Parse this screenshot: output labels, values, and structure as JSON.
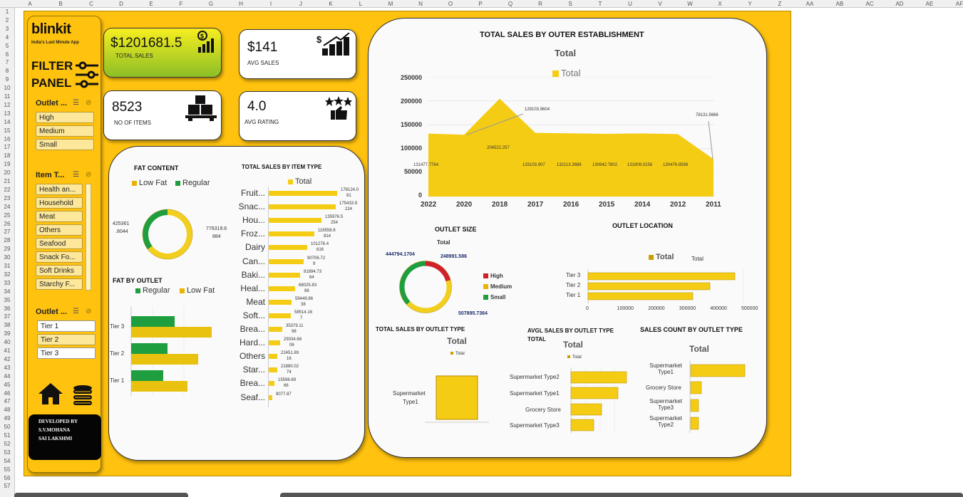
{
  "sheet": {
    "columns": [
      "A",
      "B",
      "C",
      "D",
      "E",
      "F",
      "G",
      "H",
      "I",
      "J",
      "K",
      "L",
      "M",
      "N",
      "O",
      "P",
      "Q",
      "R",
      "S",
      "T",
      "U",
      "V",
      "W",
      "X",
      "Y",
      "Z",
      "AA",
      "AB",
      "AC",
      "AD",
      "AE",
      "AF"
    ],
    "rows": [
      "1",
      "2",
      "3",
      "4",
      "5",
      "6",
      "7",
      "8",
      "9",
      "10",
      "11",
      "12",
      "13",
      "14",
      "15",
      "16",
      "17",
      "18",
      "19",
      "20",
      "21",
      "22",
      "23",
      "24",
      "25",
      "26",
      "27",
      "28",
      "29",
      "30",
      "31",
      "32",
      "33",
      "34",
      "35",
      "36",
      "37",
      "38",
      "39",
      "40",
      "41",
      "42",
      "43",
      "44",
      "45",
      "46",
      "47",
      "48",
      "49",
      "50",
      "51",
      "52",
      "53",
      "54",
      "55",
      "56",
      "57"
    ]
  },
  "brand": {
    "logo": "blinkit",
    "tagline": "India's Last Minute App"
  },
  "filter_panel": {
    "title_line1": "FILTER",
    "title_line2": "PANEL"
  },
  "slicers": {
    "outlet_size": {
      "title": "Outlet ...",
      "items": [
        "High",
        "Medium",
        "Small"
      ]
    },
    "item_type": {
      "title": "Item T...",
      "items": [
        "Health an...",
        "Household",
        "Meat",
        "Others",
        "Seafood",
        "Snack Fo...",
        "Soft Drinks",
        "Starchy F..."
      ]
    },
    "outlet_location": {
      "title": "Outlet ...",
      "items": [
        "Tier 1",
        "Tier 2",
        "Tier 3"
      ]
    }
  },
  "icons": {
    "home": "home-icon",
    "database": "database-icon",
    "money": "money-chart-icon",
    "bars": "growth-bars-icon",
    "boxes": "boxes-icon",
    "rating": "rating-thumb-icon",
    "filter": "filter-icon",
    "clear_filter": "clear-filter-icon",
    "multiselect": "multiselect-icon"
  },
  "developer": {
    "line1": "DEVELOPED BY",
    "line2": "S.V.MOHANA",
    "line3": "SAI LAKSHMI"
  },
  "kpis": {
    "total_sales": {
      "value": "$1201681.5",
      "label": "TOTAL SALES"
    },
    "avg_sales": {
      "value": "$141",
      "label": "AVG SALES"
    },
    "items": {
      "value": "8523",
      "label": "NO OF ITEMS"
    },
    "rating": {
      "value": "4.0",
      "label": "AVG RATING"
    }
  },
  "colors": {
    "yellow": "#ffc20e",
    "bar_yellow": "#f5cc14",
    "green": "#1e9e3e",
    "red": "#d0202a",
    "dark": "#111111"
  },
  "fat_content": {
    "title": "FAT CONTENT",
    "legend": [
      "Low Fat",
      "Regular"
    ],
    "left_label_1": "425361",
    "left_label_2": ".8044",
    "right_label_1": "776319.6",
    "right_label_2": "884"
  },
  "fat_by_outlet": {
    "title": "FAT BY OUTLET",
    "legend": [
      "Regular",
      "Low Fat"
    ],
    "tiers": [
      "Tier 3",
      "Tier 2",
      "Tier 1"
    ]
  },
  "item_type_chart": {
    "title": "TOTAL SALES BY ITEM TYPE",
    "legend": "Total",
    "items": [
      {
        "label": "Fruit...",
        "v1": "178124.0",
        "v2": "81"
      },
      {
        "label": "Snac...",
        "v1": "175433.9",
        "v2": "224"
      },
      {
        "label": "Hou...",
        "v1": "135976.5",
        "v2": "254"
      },
      {
        "label": "Froz...",
        "v1": "118558.8",
        "v2": "814"
      },
      {
        "label": "Dairy",
        "v1": "101276.4",
        "v2": "616"
      },
      {
        "label": "Can...",
        "v1": "90706.72",
        "v2": "9"
      },
      {
        "label": "Baki...",
        "v1": "81894.73",
        "v2": "64"
      },
      {
        "label": "Heal...",
        "v1": "68025.83",
        "v2": "88"
      },
      {
        "label": "Meat",
        "v1": "59449.86",
        "v2": "38"
      },
      {
        "label": "Soft...",
        "v1": "58514.16",
        "v2": "7"
      },
      {
        "label": "Brea...",
        "v1": "35379.11",
        "v2": "98"
      },
      {
        "label": "Hard...",
        "v1": "29334.68",
        "v2": "06"
      },
      {
        "label": "Others",
        "v1": "22451.89",
        "v2": "16"
      },
      {
        "label": "Star...",
        "v1": "21880.02",
        "v2": "74"
      },
      {
        "label": "Brea...",
        "v1": "15596.69",
        "v2": "66"
      },
      {
        "label": "Seaf...",
        "v1": "9077.87",
        "v2": ""
      }
    ]
  },
  "establishment_chart": {
    "title": "TOTAL SALES BY OUTER ESTABLISHMENT",
    "subtitle": "Total",
    "legend": "Total",
    "y_ticks": [
      "250000",
      "200000",
      "150000",
      "100000",
      "50000",
      "0"
    ],
    "years": [
      "2022",
      "2020",
      "2018",
      "2017",
      "2016",
      "2015",
      "2014",
      "2012",
      "2011"
    ],
    "labels": [
      "131477.7764",
      "129103.9604",
      "204522.257",
      "133103.907",
      "132113.3688",
      "130942.7802",
      "131809.0156",
      "130476.8598",
      "78131.5666"
    ]
  },
  "outlet_size": {
    "title": "OUTLET SIZE",
    "subtitle": "Total",
    "labels": [
      "444794.1704",
      "248991.586",
      "507895.7364"
    ],
    "legend": [
      "High",
      "Medium",
      "Small"
    ]
  },
  "outlet_location": {
    "title": "OUTLET LOCATION",
    "legend": "Total",
    "legend2": "Total",
    "tiers": [
      "Tier 3",
      "Tier 2",
      "Tier 1"
    ],
    "x_ticks": [
      "0",
      "100000",
      "200000",
      "300000",
      "400000",
      "500000"
    ]
  },
  "sales_by_type": {
    "title": "TOTAL SALES BY OUTLET TYPE",
    "subtitle": "Total",
    "legend": "Total",
    "category_1": "Supermarket",
    "category_2": "Type1"
  },
  "avg_by_type": {
    "title_1": "AVGL SALES BY OUTLET TYPE",
    "title_2": "TOTAL",
    "subtitle": "Total",
    "legend": "Total",
    "categories": [
      "Supermarket Type2",
      "Supermarket Type1",
      "Grocery Store",
      "Supermarket Type3"
    ]
  },
  "count_by_type": {
    "title": "SALES COUNT BY OUTLET TYPE",
    "subtitle": "Total",
    "categories": [
      [
        "Supermarket",
        "Type1"
      ],
      [
        "Grocery Store",
        ""
      ],
      [
        "Supermarket",
        "Type3"
      ],
      [
        "Supermarket",
        "Type2"
      ]
    ]
  }
}
